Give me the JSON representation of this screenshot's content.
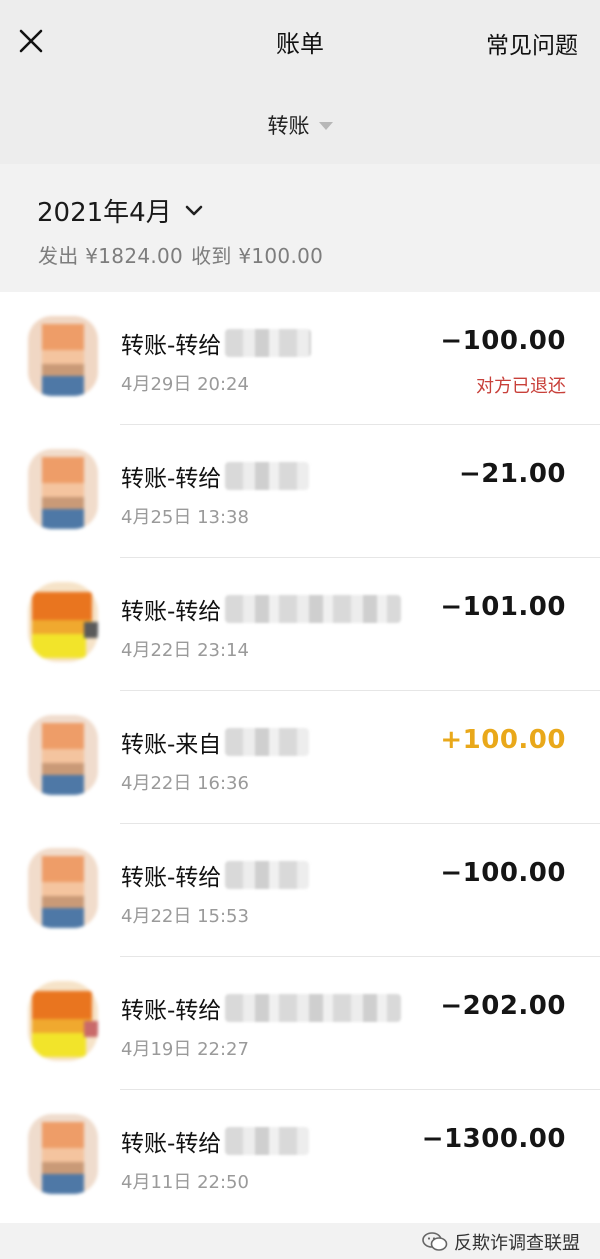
{
  "header": {
    "title": "账单",
    "faq_label": "常见问题",
    "filter_label": "转账"
  },
  "month": {
    "label": "2021年4月",
    "sent": "发出 ¥1824.00",
    "received": "收到 ¥100.00"
  },
  "transactions": [
    {
      "name": "转账-转给",
      "time": "4月29日 20:24",
      "amount": "−100.00",
      "status": "对方已退还",
      "direction": "out"
    },
    {
      "name": "转账-转给",
      "time": "4月25日 13:38",
      "amount": "−21.00",
      "status": "",
      "direction": "out"
    },
    {
      "name": "转账-转给",
      "time": "4月22日 23:14",
      "amount": "−101.00",
      "status": "",
      "direction": "out"
    },
    {
      "name": "转账-来自",
      "time": "4月22日 16:36",
      "amount": "+100.00",
      "status": "",
      "direction": "in"
    },
    {
      "name": "转账-转给",
      "time": "4月22日 15:53",
      "amount": "−100.00",
      "status": "",
      "direction": "out"
    },
    {
      "name": "转账-转给",
      "time": "4月19日 22:27",
      "amount": "−202.00",
      "status": "",
      "direction": "out"
    },
    {
      "name": "转账-转给",
      "time": "4月11日 22:50",
      "amount": "−1300.00",
      "status": "",
      "direction": "out"
    }
  ],
  "watermark": {
    "text": "反欺诈调查联盟"
  },
  "colors": {
    "income": "#e9a81a",
    "refund_status": "#c8403a",
    "background": "#ededed"
  }
}
